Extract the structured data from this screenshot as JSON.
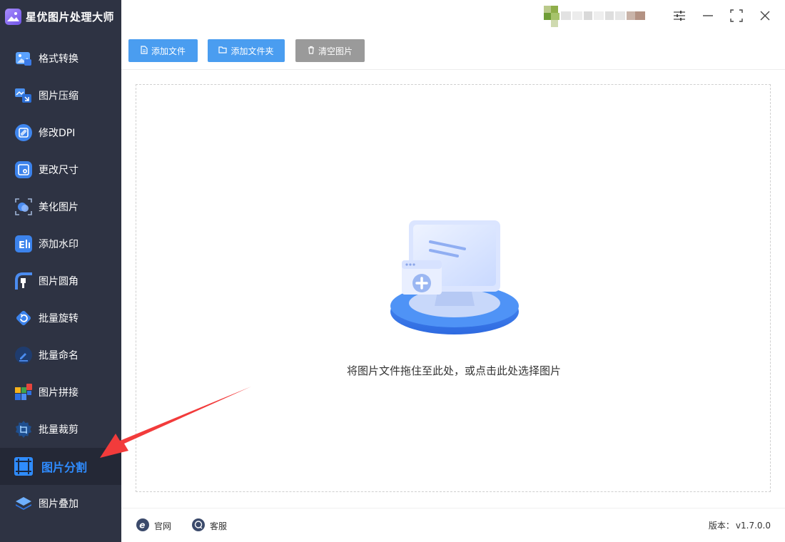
{
  "app": {
    "title": "星优图片处理大师"
  },
  "sidebar": {
    "items": [
      {
        "label": "格式转换",
        "icon": "image-convert-icon"
      },
      {
        "label": "图片压缩",
        "icon": "image-compress-icon"
      },
      {
        "label": "修改DPI",
        "icon": "dpi-icon"
      },
      {
        "label": "更改尺寸",
        "icon": "resize-icon"
      },
      {
        "label": "美化图片",
        "icon": "beautify-icon"
      },
      {
        "label": "添加水印",
        "icon": "watermark-icon"
      },
      {
        "label": "图片圆角",
        "icon": "round-corner-icon"
      },
      {
        "label": "批量旋转",
        "icon": "rotate-icon"
      },
      {
        "label": "批量命名",
        "icon": "rename-icon"
      },
      {
        "label": "图片拼接",
        "icon": "stitch-icon"
      },
      {
        "label": "批量裁剪",
        "icon": "crop-icon"
      },
      {
        "label": "图片分割",
        "icon": "split-icon",
        "active": true
      },
      {
        "label": "图片叠加",
        "icon": "layers-icon"
      }
    ]
  },
  "toolbar": {
    "add_file": "添加文件",
    "add_folder": "添加文件夹",
    "clear_images": "清空图片"
  },
  "dropzone": {
    "hint": "将图片文件拖住至此处，或点击此处选择图片"
  },
  "footer": {
    "website": "官网",
    "support": "客服",
    "version_label": "版本：",
    "version_value": "v1.7.0.0"
  },
  "colors": {
    "sidebar_bg": "#2e3343",
    "active_item_bg": "#242836",
    "accent_blue": "#2f8cff",
    "button_blue": "#4a9df0",
    "button_gray": "#9a9a9a",
    "arrow_red": "#f23b3b"
  }
}
